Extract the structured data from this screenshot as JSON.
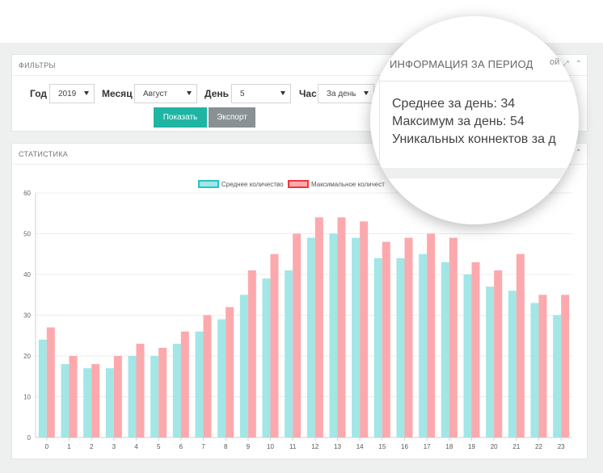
{
  "filters": {
    "header": "ФИЛЬТРЫ",
    "year_label": "Год",
    "year_value": "2019",
    "month_label": "Месяц",
    "month_value": "Август",
    "day_label": "День",
    "day_value": "5",
    "hour_label": "Час",
    "hour_value": "За день",
    "show_button": "Показать",
    "export_button": "Экспорт"
  },
  "stats": {
    "header": "СТАТИСТИКА"
  },
  "period_info": {
    "title": "ИНФОРМАЦИЯ ЗА ПЕРИОД",
    "avg_line": "Среднее за день: 34",
    "max_line": "Максимум за день: 54",
    "unique_line": "Уникальных коннектов за д",
    "tool_fragment": "ой"
  },
  "colors": {
    "avg_fill": "#a2e6e6",
    "avg_stroke": "#2bc3c3",
    "max_fill": "#fca9ad",
    "max_stroke": "#f0363e",
    "accent": "#1fb5a3",
    "export": "#8a9194"
  },
  "chart_data": {
    "type": "bar",
    "categories": [
      "0",
      "1",
      "2",
      "3",
      "4",
      "5",
      "6",
      "7",
      "8",
      "9",
      "10",
      "11",
      "12",
      "13",
      "14",
      "15",
      "16",
      "17",
      "18",
      "19",
      "20",
      "21",
      "22",
      "23"
    ],
    "series": [
      {
        "name": "Среднее количество",
        "values": [
          24,
          18,
          17,
          17,
          20,
          20,
          23,
          26,
          29,
          35,
          39,
          41,
          49,
          50,
          49,
          44,
          44,
          45,
          43,
          40,
          37,
          36,
          33,
          30
        ]
      },
      {
        "name": "Максимальное количест",
        "values": [
          27,
          20,
          18,
          20,
          23,
          22,
          26,
          30,
          32,
          41,
          45,
          50,
          54,
          54,
          53,
          48,
          49,
          50,
          49,
          43,
          41,
          45,
          35,
          35
        ]
      }
    ],
    "yticks": [
      "0",
      "10",
      "20",
      "30",
      "40",
      "50",
      "60"
    ],
    "ylim": [
      0,
      60
    ],
    "grid": true,
    "legend": "top"
  }
}
